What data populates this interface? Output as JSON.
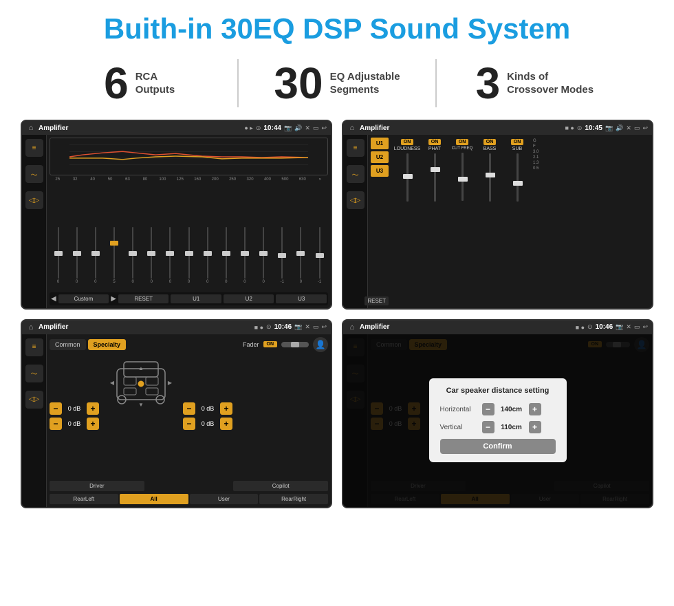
{
  "header": {
    "title": "Buith-in 30EQ DSP Sound System"
  },
  "stats": [
    {
      "number": "6",
      "label": "RCA\nOutputs"
    },
    {
      "number": "30",
      "label": "EQ Adjustable\nSegments"
    },
    {
      "number": "3",
      "label": "Kinds of\nCrossover Modes"
    }
  ],
  "screens": [
    {
      "id": "screen1",
      "statusBar": {
        "title": "Amplifier",
        "time": "10:44",
        "icons": [
          "▸",
          "🔊",
          "✕",
          "▭",
          "↩"
        ]
      },
      "type": "eq"
    },
    {
      "id": "screen2",
      "statusBar": {
        "title": "Amplifier",
        "time": "10:45",
        "icons": [
          "🔊",
          "✕",
          "▭",
          "↩"
        ]
      },
      "type": "amp"
    },
    {
      "id": "screen3",
      "statusBar": {
        "title": "Amplifier",
        "time": "10:46",
        "icons": [
          "🔊",
          "✕",
          "▭",
          "↩"
        ]
      },
      "type": "speaker"
    },
    {
      "id": "screen4",
      "statusBar": {
        "title": "Amplifier",
        "time": "10:46",
        "icons": [
          "🔊",
          "✕",
          "▭",
          "↩"
        ]
      },
      "type": "distance",
      "dialog": {
        "title": "Car speaker distance setting",
        "horizontal": {
          "label": "Horizontal",
          "value": "140cm"
        },
        "vertical": {
          "label": "Vertical",
          "value": "110cm"
        },
        "confirmLabel": "Confirm"
      }
    }
  ],
  "eq": {
    "frequencies": [
      "25",
      "32",
      "40",
      "50",
      "63",
      "80",
      "100",
      "125",
      "160",
      "200",
      "250",
      "320",
      "400",
      "500",
      "630"
    ],
    "values": [
      "0",
      "0",
      "0",
      "5",
      "0",
      "0",
      "0",
      "0",
      "0",
      "0",
      "0",
      "0",
      "-1",
      "0",
      "-1"
    ],
    "presets": [
      "Custom",
      "RESET",
      "U1",
      "U2",
      "U3"
    ]
  },
  "amp": {
    "presets": [
      "U1",
      "U2",
      "U3"
    ],
    "channels": [
      "LOUDNESS",
      "PHAT",
      "CUT FREQ",
      "BASS",
      "SUB"
    ],
    "resetLabel": "RESET"
  },
  "speaker": {
    "tabs": [
      "Common",
      "Specialty"
    ],
    "faderLabel": "Fader",
    "onLabel": "ON",
    "volRows": [
      "-  0 dB  +",
      "-  0 dB  +",
      "-  0 dB  +",
      "-  0 dB  +"
    ],
    "bottomBtns": [
      "Driver",
      "",
      "Copilot",
      "RearLeft",
      "All",
      "User",
      "RearRight"
    ]
  },
  "distance": {
    "title": "Car speaker distance setting",
    "horizontalLabel": "Horizontal",
    "horizontalValue": "140cm",
    "verticalLabel": "Vertical",
    "verticalValue": "110cm",
    "confirmLabel": "Confirm",
    "tabs": [
      "Common",
      "Specialty"
    ],
    "onLabel": "ON",
    "rightVol1": "0 dB",
    "rightVol2": "0 dB",
    "bottomBtns": [
      "Driver",
      "",
      "Copilot",
      "RearLeft",
      "User",
      "RearRight"
    ]
  }
}
